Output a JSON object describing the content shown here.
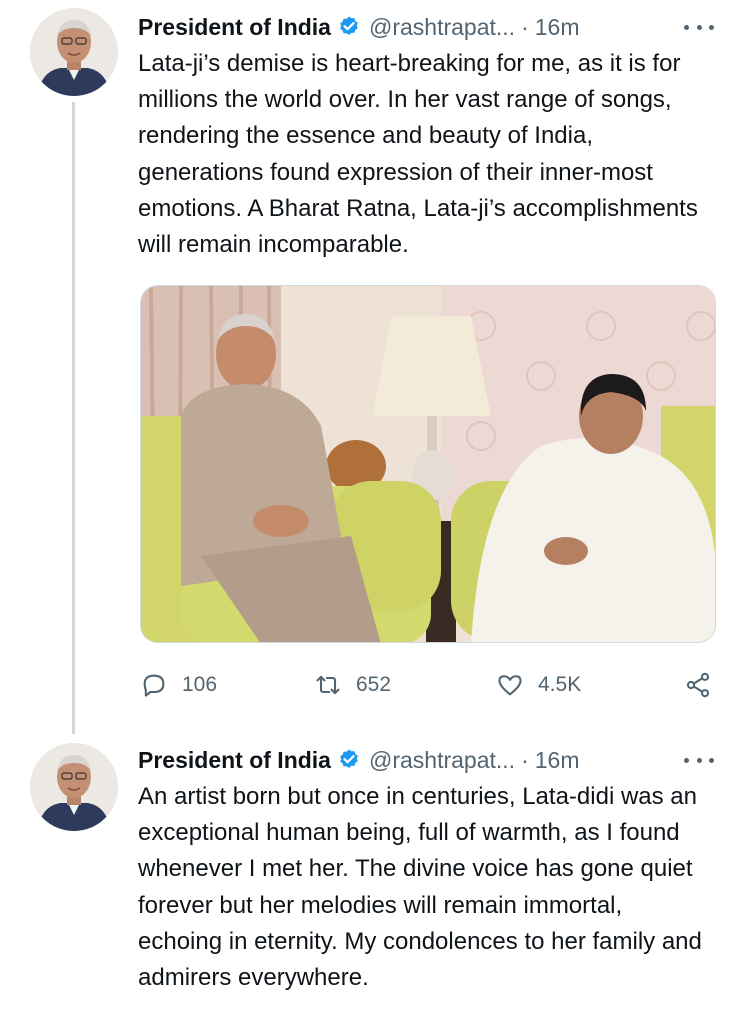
{
  "tweets": [
    {
      "author_name": "President of India",
      "handle": "@rashtrapat...",
      "separator": "·",
      "time": "16m",
      "text": "Lata-ji’s demise is heart-breaking for me, as it is for millions the world over. In her vast range of songs, rendering the essence and beauty of India, generations found expression of their inner-most emotions. A Bharat Ratna, Lata-ji’s accomplishments will remain incomparable.",
      "stats": {
        "replies": "106",
        "retweets": "652",
        "likes": "4.5K"
      }
    },
    {
      "author_name": "President of India",
      "handle": "@rashtrapat...",
      "separator": "·",
      "time": "16m",
      "text": "An artist born but once in centuries, Lata-didi was an exceptional human being, full of warmth, as I found whenever I met her. The divine voice has gone quiet forever but her melodies will remain immortal, echoing in eternity. My condolences to her family and admirers everywhere."
    }
  ],
  "colors": {
    "text_primary": "#0f1419",
    "text_secondary": "#536471",
    "verified_blue": "#1d9bf0",
    "thread_line": "#cfd9de"
  },
  "icons": [
    "verified-badge-icon",
    "more-icon",
    "reply-icon",
    "retweet-icon",
    "like-icon",
    "share-icon"
  ]
}
